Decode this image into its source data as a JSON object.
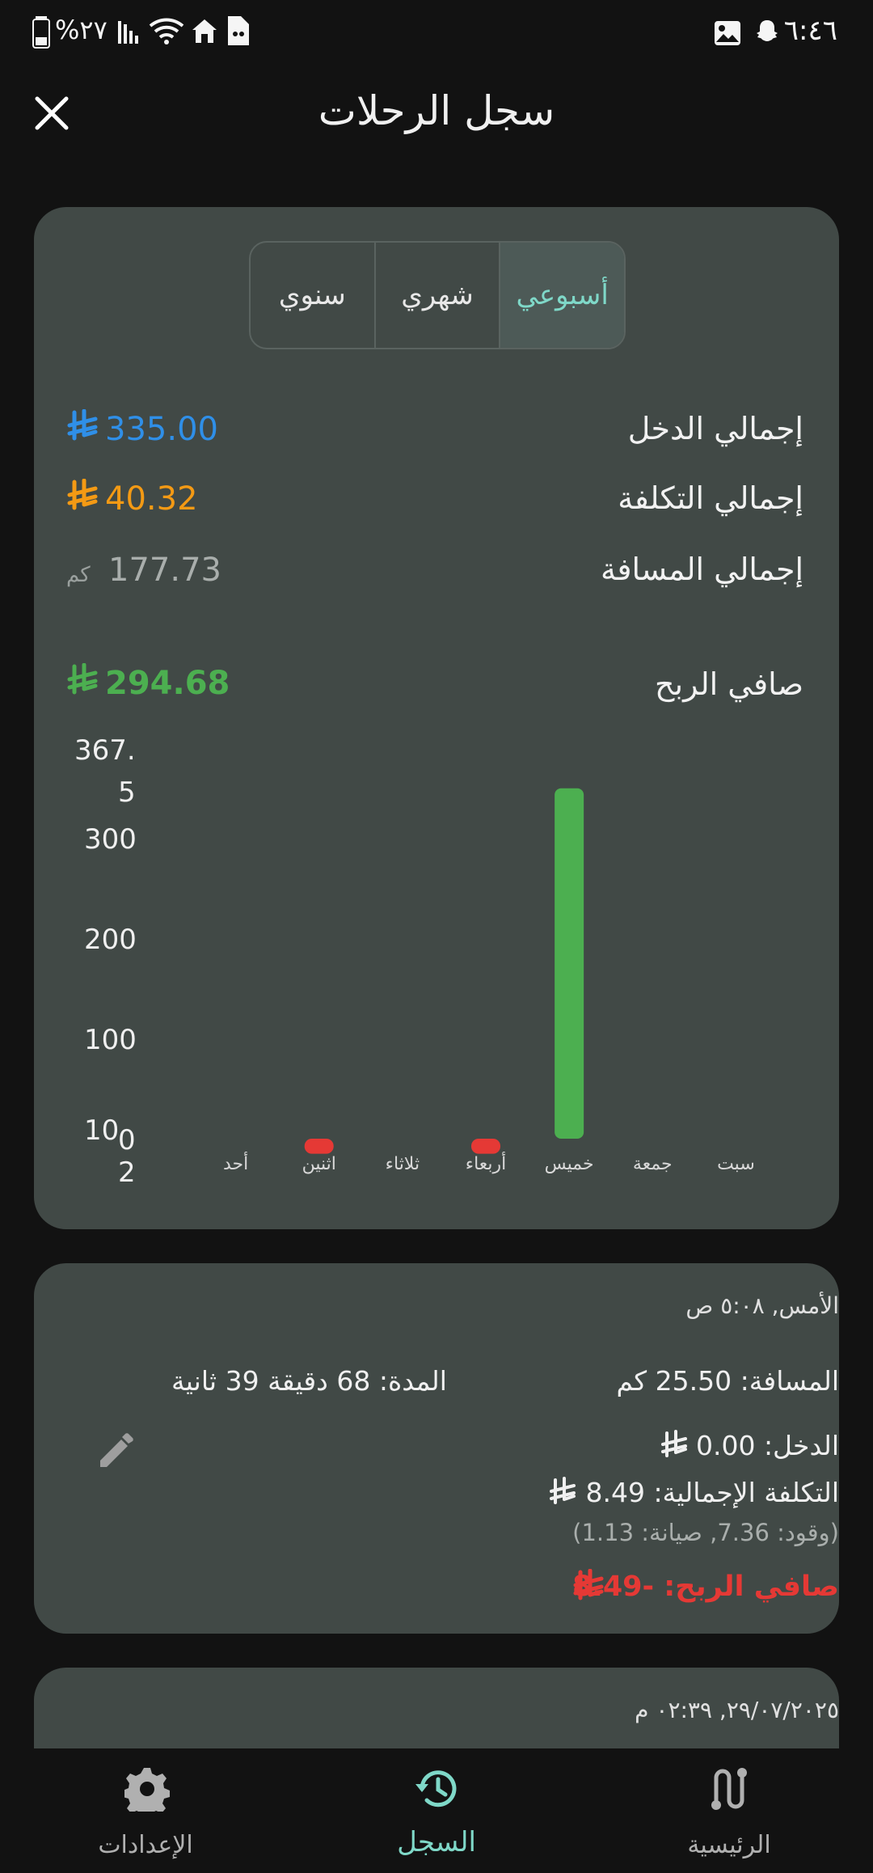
{
  "status_bar": {
    "time": "٦:٤٦",
    "battery_pct": "%٢٧"
  },
  "header": {
    "title": "سجل الرحلات"
  },
  "period_tabs": [
    {
      "label": "أسبوعي",
      "active": true
    },
    {
      "label": "شهري",
      "active": false
    },
    {
      "label": "سنوي",
      "active": false
    }
  ],
  "summary": {
    "income_label": "إجمالي الدخل",
    "income_value": "335.00",
    "cost_label": "إجمالي التكلفة",
    "cost_value": "40.32",
    "distance_label": "إجمالي المسافة",
    "distance_value": "177.73",
    "distance_unit": "كم",
    "net_label": "صافي الربح",
    "net_value": "294.68",
    "currency_symbol": "⃁"
  },
  "colors": {
    "income": "#2f8fe8",
    "cost": "#f49a14",
    "net": "#4caf50",
    "loss": "#e53935",
    "accent": "#7fd8c8"
  },
  "chart_data": {
    "type": "bar",
    "categories": [
      "سبت",
      "جمعة",
      "خميس",
      "أربعاء",
      "ثلاثاء",
      "اثنين",
      "أحد"
    ],
    "values": [
      0,
      0,
      335,
      -8.49,
      0,
      -8.49,
      0
    ],
    "y_ticks": [
      "367.\n5",
      "300",
      "200",
      "100",
      "10",
      "0",
      "2"
    ],
    "ylim": [
      -10,
      367.5
    ],
    "title": "",
    "xlabel": "",
    "ylabel": ""
  },
  "y_tick_labels": {
    "t1a": "367.",
    "t1b": "5",
    "t2": "300",
    "t3": "200",
    "t4": "100",
    "t5a": "10",
    "t5b": "0",
    "t5c": "2"
  },
  "trip": {
    "date": "الأمس, ٥:٠٨ ص",
    "distance": "المسافة: 25.50 كم",
    "duration": "المدة: 68 دقيقة 39 ثانية",
    "income": "الدخل: 0.00",
    "total_cost": "التكلفة الإجمالية: 8.49",
    "breakdown": "(وقود: 7.36, صيانة: 1.13)",
    "net": "صافي الربح: -8.49"
  },
  "trip2": {
    "date": "٢٩/٠٧/٢٠٢٥, ٠٢:٣٩ م"
  },
  "bottom_nav": [
    {
      "label": "الرئيسية",
      "icon": "route-icon",
      "active": false
    },
    {
      "label": "السجل",
      "icon": "history-icon",
      "active": true
    },
    {
      "label": "الإعدادات",
      "icon": "gear-icon",
      "active": false
    }
  ]
}
